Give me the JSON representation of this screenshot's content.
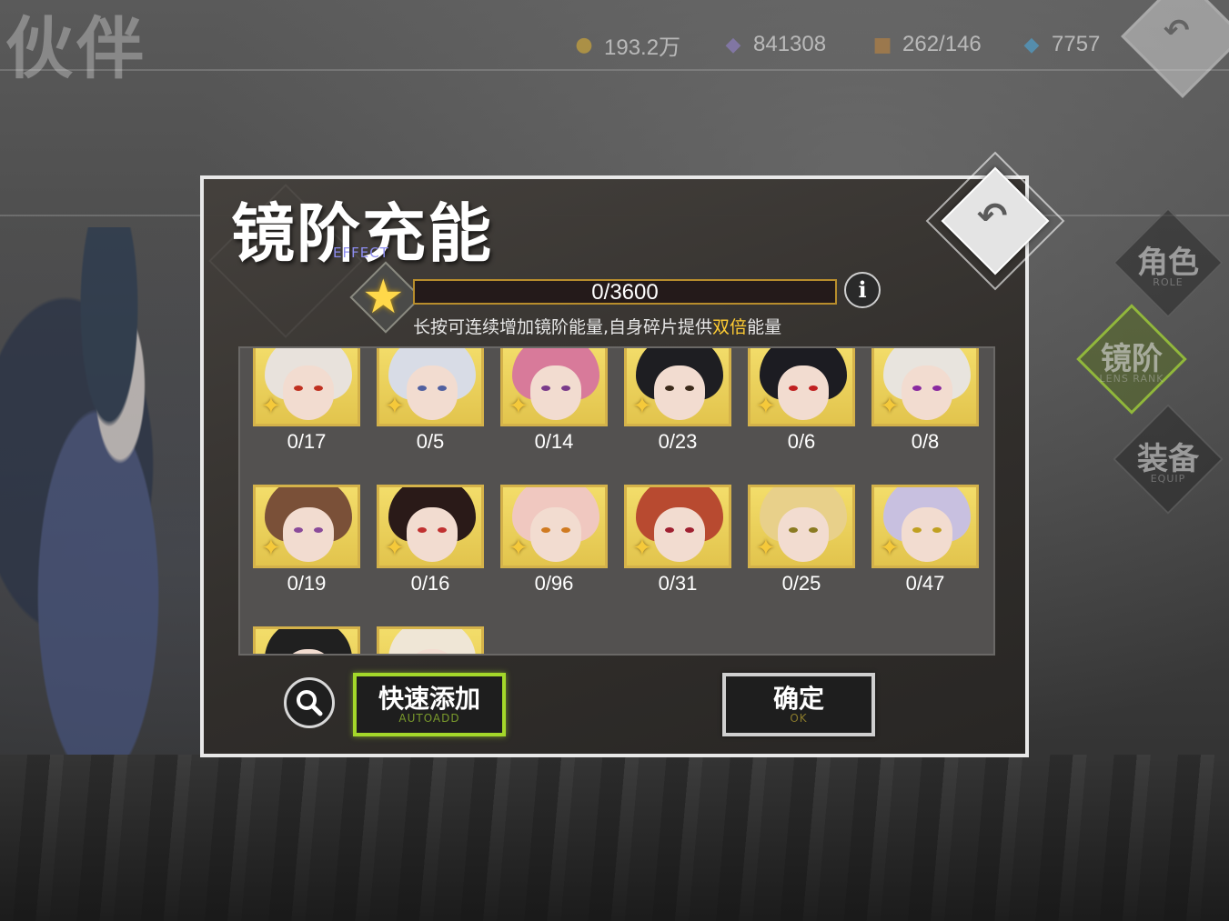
{
  "page_title": "伙伴",
  "currencies": [
    {
      "icon": "gold-coin-icon",
      "value": "193.2万"
    },
    {
      "icon": "crystal-icon",
      "value": "841308"
    },
    {
      "icon": "chest-icon",
      "value": "262/146"
    },
    {
      "icon": "gem-icon",
      "value": "7757"
    }
  ],
  "side_tabs": [
    {
      "label": "角色",
      "sub": "ROLE",
      "active": false
    },
    {
      "label": "镜阶",
      "sub": "LENS RANK",
      "active": true
    },
    {
      "label": "装备",
      "sub": "EQUIP",
      "active": false
    }
  ],
  "modal": {
    "title": "镜阶充能",
    "title_sub": "EFFECT",
    "progress": {
      "current": 0,
      "max": 3600,
      "text": "0/3600"
    },
    "info_label": "i",
    "hint_prefix": "长按可连续增加镜阶能量,自身碎片提供",
    "hint_highlight": "双倍",
    "hint_suffix": "能量",
    "cards": [
      {
        "count": "0/17"
      },
      {
        "count": "0/5"
      },
      {
        "count": "0/14"
      },
      {
        "count": "0/23"
      },
      {
        "count": "0/6"
      },
      {
        "count": "0/8"
      },
      {
        "count": "0/19"
      },
      {
        "count": "0/16"
      },
      {
        "count": "0/96"
      },
      {
        "count": "0/31"
      },
      {
        "count": "0/25"
      },
      {
        "count": "0/47"
      },
      {
        "count": ""
      },
      {
        "count": ""
      }
    ],
    "quick_add_label": "快速添加",
    "quick_add_sub": "AUTOADD",
    "ok_label": "确定",
    "ok_sub": "OK"
  },
  "colors": {
    "accent_green": "#a4d82a",
    "highlight_gold": "#ffcc33",
    "frame_gold": "#d4b24a"
  }
}
